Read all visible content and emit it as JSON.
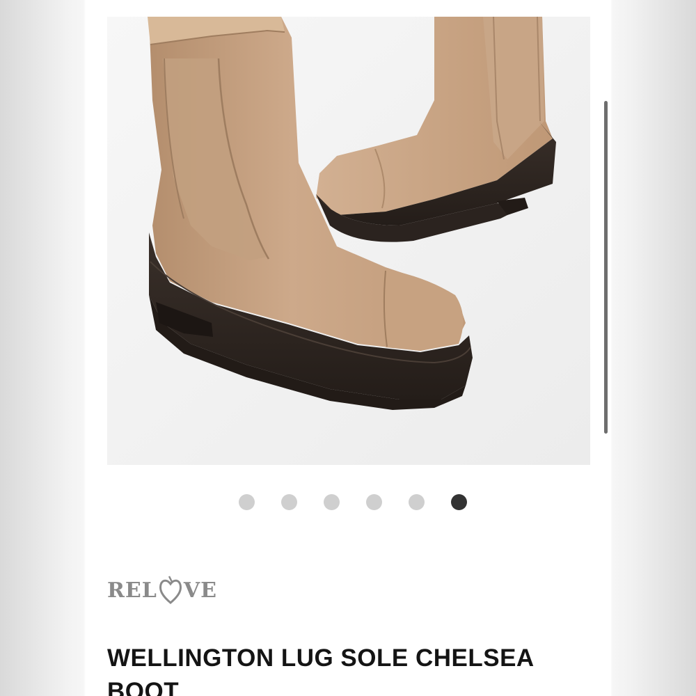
{
  "gallery": {
    "image_alt": "Tan leather chelsea boots with dark brown lug soles",
    "total_slides": 6,
    "active_slide": 6
  },
  "brand": {
    "logo_text_before": "REL",
    "logo_text_after": "VE",
    "logo_full": "RELOVE"
  },
  "product": {
    "title": "WELLINGTON LUG SOLE CHELSEA BOOT"
  },
  "colors": {
    "dot_inactive": "#cfcfcf",
    "dot_active": "#333333",
    "boot_leather": "#c9a584",
    "boot_sole": "#2e2621",
    "title_text": "#141414",
    "logo_gray": "#8a8a8a"
  }
}
